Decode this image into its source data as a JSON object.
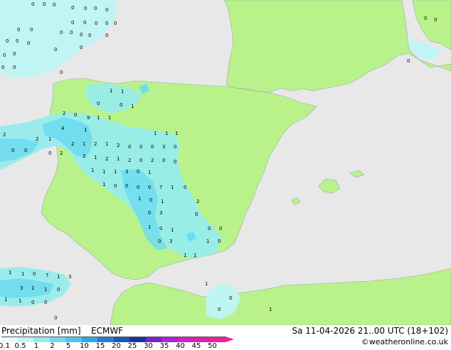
{
  "footer": {
    "title_left": "Precipitation [mm]",
    "model": "ECMWF",
    "datetime": "Sa 11-04-2026 21..00 UTC (18+102)",
    "credit": "©weatheronline.co.uk"
  },
  "legend": {
    "ticks": [
      "0.1",
      "0.5",
      "1",
      "2",
      "5",
      "10",
      "15",
      "20",
      "25",
      "30",
      "35",
      "40",
      "45",
      "50"
    ],
    "colors": [
      "#e6fafa",
      "#bff4f4",
      "#96ecec",
      "#6ddcf0",
      "#4ac6ec",
      "#28a8e6",
      "#1f7fd6",
      "#1a56c4",
      "#1c2fa8",
      "#7a1fd0",
      "#b01ee0",
      "#d61ec8",
      "#e01eb0",
      "#f01e9c"
    ]
  },
  "map": {
    "land_color": "#b9f28a",
    "sea_color": "#e8e8e8",
    "labels": [
      "0",
      "0",
      "0",
      "0",
      "0",
      "0",
      "0",
      "0",
      "0",
      "0",
      "0",
      "0",
      "0",
      "0",
      "0",
      "0",
      "0",
      "0",
      "0",
      "0",
      "0",
      "0",
      "0",
      "0",
      "0",
      "0",
      "0",
      "0",
      "0",
      "1",
      "1",
      "2",
      "0",
      "0",
      "1",
      "2",
      "0",
      "4",
      "1",
      "9",
      "1",
      "1",
      "2",
      "1",
      "2",
      "1",
      "2",
      "1",
      "2",
      "0",
      "0",
      "0",
      "3",
      "0",
      "0",
      "0",
      "0",
      "2",
      "2",
      "1",
      "2",
      "1",
      "2",
      "0",
      "2",
      "0",
      "0",
      "1",
      "1",
      "1",
      "1",
      "1",
      "1",
      "3",
      "0",
      "1",
      "1",
      "0",
      "0",
      "0",
      "0",
      "7",
      "1",
      "0",
      "1",
      "0",
      "1",
      "2",
      "0",
      "3",
      "0",
      "1",
      "0",
      "1",
      "0",
      "0",
      "0",
      "3",
      "1",
      "0",
      "1",
      "1",
      "1",
      "1",
      "0",
      "7",
      "1",
      "3",
      "3",
      "1",
      "1",
      "0",
      "1",
      "1",
      "0",
      "0",
      "0",
      "1",
      "0",
      "0",
      "1",
      "0",
      "0",
      "0"
    ]
  }
}
